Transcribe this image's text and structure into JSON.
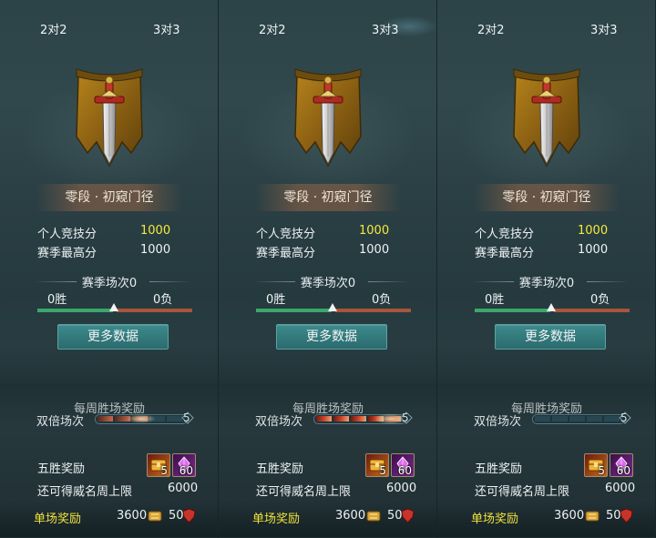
{
  "panels": [
    {
      "tab_left": "2对2",
      "tab_right": "3对3",
      "active_tab": "left",
      "rank_name": "零段 · 初窥门径",
      "personal_score_label": "个人竞技分",
      "personal_score": "1000",
      "season_high_label": "赛季最高分",
      "season_high": "1000",
      "season_matches": "赛季场次0",
      "wins": "0胜",
      "losses": "0负",
      "more_data": "更多数据",
      "weekly_reward": "每周胜场奖励",
      "double_label": "双倍场次",
      "double_count": "5",
      "double_progress_state": "sparkle",
      "five_win_label": "五胜奖励",
      "five_win_item1_count": "5",
      "five_win_item2_count": "60",
      "remaining_label": "还可得威名周上限",
      "remaining_value": "6000",
      "single_label": "单场奖励",
      "single_value1": "3600",
      "single_value2": "50"
    },
    {
      "tab_left": "2对2",
      "tab_right": "3对3",
      "active_tab": "right",
      "rank_name": "零段 · 初窥门径",
      "personal_score_label": "个人竞技分",
      "personal_score": "1000",
      "season_high_label": "赛季最高分",
      "season_high": "1000",
      "season_matches": "赛季场次0",
      "wins": "0胜",
      "losses": "0负",
      "more_data": "更多数据",
      "weekly_reward": "每周胜场奖励",
      "double_label": "双倍场次",
      "double_count": "5",
      "double_progress_state": "fire",
      "five_win_label": "五胜奖励",
      "five_win_item1_count": "5",
      "five_win_item2_count": "60",
      "remaining_label": "还可得威名周上限",
      "remaining_value": "6000",
      "single_label": "单场奖励",
      "single_value1": "3600",
      "single_value2": "50"
    },
    {
      "tab_left": "2对2",
      "tab_right": "3对3",
      "active_tab": "none",
      "rank_name": "零段 · 初窥门径",
      "personal_score_label": "个人竞技分",
      "personal_score": "1000",
      "season_high_label": "赛季最高分",
      "season_high": "1000",
      "season_matches": "赛季场次0",
      "wins": "0胜",
      "losses": "0负",
      "more_data": "更多数据",
      "weekly_reward": "每周胜场奖励",
      "double_label": "双倍场次",
      "double_count": "5",
      "double_progress_state": "idle",
      "five_win_label": "五胜奖励",
      "five_win_item1_count": "5",
      "five_win_item2_count": "60",
      "remaining_label": "还可得威名周上限",
      "remaining_value": "6000",
      "single_label": "单场奖励",
      "single_value1": "3600",
      "single_value2": "50"
    }
  ],
  "colors": {
    "score_yellow": "#f5ea3a",
    "win_bar": "#3aa86a",
    "loss_bar": "#a8553b",
    "button": "#2f7477",
    "single_reward_label": "#f1e23a"
  },
  "icons": {
    "rank_emblem": "sword-banner-icon",
    "reward_item1": "scroll-chest-icon",
    "reward_item2": "purple-gem-icon",
    "currency1": "gold-coin-icon",
    "currency2": "red-shield-icon"
  }
}
